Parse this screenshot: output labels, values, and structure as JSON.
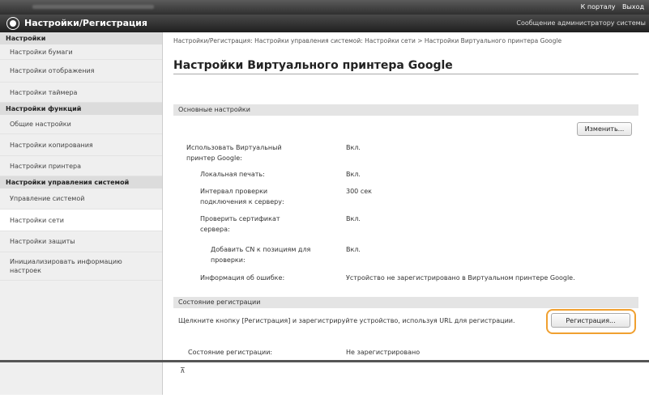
{
  "topbar": {
    "blurred_text": "",
    "link_portal": "К порталу",
    "link_logout": "Выход"
  },
  "header": {
    "title": "Настройки/Регистрация",
    "admin_message": "Сообщение администратору системы"
  },
  "sidebar": {
    "sections": [
      {
        "heading": "Настройки",
        "items": [
          "Настройки бумаги",
          "Настройки отображения",
          "Настройки таймера"
        ]
      },
      {
        "heading": "Настройки функций",
        "items": [
          "Общие настройки",
          "Настройки копирования",
          "Настройки принтера"
        ]
      },
      {
        "heading": "Настройки управления системой",
        "items": [
          "Управление системой",
          "Настройки сети",
          "Настройки защиты",
          "Инициализировать информацию настроек"
        ]
      }
    ],
    "active_item": "Настройки сети"
  },
  "main": {
    "breadcrumb": "Настройки/Регистрация: Настройки управления системой: Настройки сети > Настройки Виртуального принтера Google",
    "title": "Настройки Виртуального принтера Google",
    "basic": {
      "heading": "Основные настройки",
      "edit_button": "Изменить...",
      "rows": [
        {
          "label": "Использовать Виртуальный принтер Google:",
          "value": "Вкл."
        },
        {
          "label": "Локальная печать:",
          "value": "Вкл."
        },
        {
          "label": "Интервал проверки подключения к серверу:",
          "value": "300 сек"
        },
        {
          "label": "Проверить сертификат сервера:",
          "value": "Вкл."
        },
        {
          "label": "Добавить CN к позициям для проверки:",
          "value": "Вкл."
        },
        {
          "label": "Информация об ошибке:",
          "value": "Устройство не зарегистрировано в Виртуальном принтере Google."
        }
      ]
    },
    "registration": {
      "heading": "Состояние регистрации",
      "instruction": "Щелкните кнопку [Регистрация] и зарегистрируйте устройство, используя URL для регистрации.",
      "register_button": "Регистрация...",
      "status_label": "Состояние регистрации:",
      "status_value": "Не зарегистрировано"
    },
    "to_top_icon": "arrow-to-top"
  },
  "colors": {
    "highlight": "#f0a030",
    "header": "#2f2f2f"
  }
}
